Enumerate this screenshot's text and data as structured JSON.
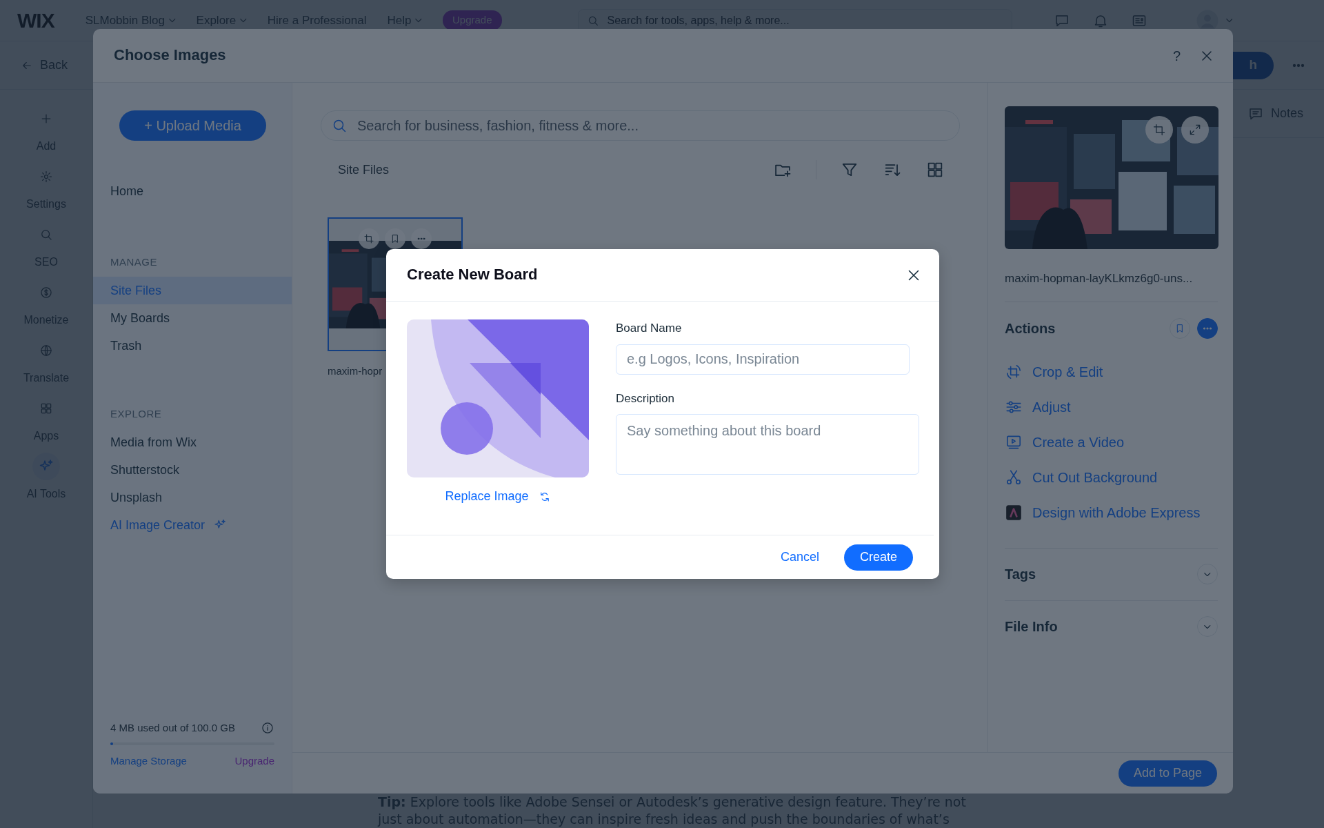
{
  "topbar": {
    "logo": "WIX",
    "site": "SLMobbin Blog",
    "menus": [
      {
        "label": "Explore",
        "dropdown": true
      },
      {
        "label": "Hire a Professional",
        "dropdown": false
      },
      {
        "label": "Help",
        "dropdown": true
      }
    ],
    "upgrade": "Upgrade",
    "search_placeholder": "Search for tools, apps, help & more..."
  },
  "subbar": {
    "back": "Back",
    "publish": "h"
  },
  "rail": [
    {
      "label": "Add",
      "kind": "plus"
    },
    {
      "label": "Settings",
      "kind": "gear"
    },
    {
      "label": "SEO",
      "kind": "search"
    },
    {
      "label": "Monetize",
      "kind": "dollar"
    },
    {
      "label": "Translate",
      "kind": "globe"
    },
    {
      "label": "Apps",
      "kind": "apps"
    },
    {
      "label": "AI Tools",
      "kind": "ai"
    }
  ],
  "notes": "Notes",
  "tip": {
    "lines": [
      "**Tip:** Explore tools like Adobe Sensei or Autodesk’s generative design feature. They’re not",
      "just about automation—they can inspire fresh ideas and push the boundaries of what’s"
    ]
  },
  "dialog": {
    "title": "Choose Images",
    "help": "?",
    "upload": "+ Upload Media",
    "nav": [
      {
        "label": "Home",
        "kind": "item",
        "selected": false
      },
      {
        "label": "MANAGE",
        "kind": "header"
      },
      {
        "label": "Site Files",
        "kind": "item",
        "selected": true
      },
      {
        "label": "My Boards",
        "kind": "item",
        "selected": false
      },
      {
        "label": "Trash",
        "kind": "item",
        "selected": false
      },
      {
        "label": "EXPLORE",
        "kind": "header"
      },
      {
        "label": "Media from Wix",
        "kind": "item",
        "selected": false
      },
      {
        "label": "Shutterstock",
        "kind": "item",
        "selected": false
      },
      {
        "label": "Unsplash",
        "kind": "item",
        "selected": false
      },
      {
        "label": "AI Image Creator",
        "kind": "ai",
        "selected": false
      }
    ],
    "storage": {
      "text": "4 MB used out of 100.0 GB",
      "level": 0,
      "manage": "Manage Storage",
      "upgrade": "Upgrade"
    },
    "search_placeholder": "Search for business, fashion, fitness & more...",
    "folder": "Site Files",
    "files": [
      {
        "name": "maxim-hopr",
        "selected": true
      }
    ],
    "details": {
      "filename": "maxim-hopman-layKLkmz6g0-uns...",
      "actions_title": "Actions",
      "actions": [
        {
          "label": "Crop & Edit",
          "kind": "crop"
        },
        {
          "label": "Adjust",
          "kind": "adjust"
        },
        {
          "label": "Create a Video",
          "kind": "video"
        },
        {
          "label": "Cut Out Background",
          "kind": "cutout"
        },
        {
          "label": "Design with Adobe Express",
          "kind": "adobe"
        }
      ],
      "sections": [
        {
          "label": "Tags",
          "expanded": false
        },
        {
          "label": "File Info",
          "expanded": false
        }
      ]
    },
    "add_button": "Add to Page"
  },
  "modal": {
    "title": "Create New Board",
    "replace": "Replace Image",
    "fields": [
      {
        "label": "Board Name",
        "placeholder": "e.g Logos, Icons, Inspiration",
        "kind": "input"
      },
      {
        "label": "Description",
        "placeholder": "Say something about this board",
        "kind": "textarea"
      }
    ],
    "cancel": "Cancel",
    "create": "Create"
  }
}
